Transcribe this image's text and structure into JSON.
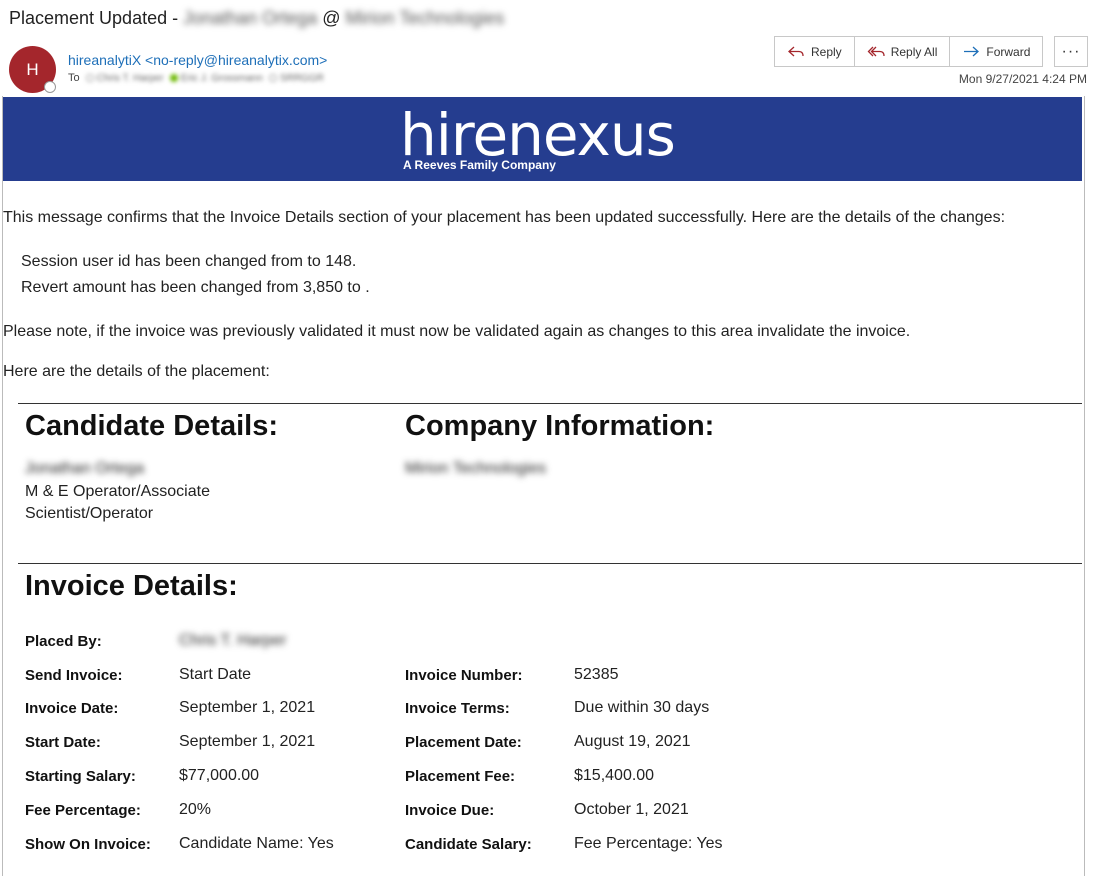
{
  "email": {
    "subject_prefix": "Placement Updated -",
    "subject_candidate": "Jonathan Ortega",
    "subject_at": "@",
    "subject_company": "Mirion Technologies",
    "avatar_letter": "H",
    "sender": "hireanalytiX <no-reply@hireanalytix.com>",
    "to_label": "To",
    "recipients": [
      "Chris T. Harper",
      "Eric J. Grossmann",
      "SRRGGR"
    ],
    "datetime": "Mon 9/27/2021 4:24 PM"
  },
  "actions": {
    "reply": "Reply",
    "reply_all": "Reply All",
    "forward": "Forward",
    "more": "···"
  },
  "banner": {
    "logo_text": "hirenexus",
    "tagline": "A Reeves Family Company",
    "color": "#253d8f"
  },
  "body": {
    "intro": "This message confirms that the Invoice Details section of your placement has been updated successfully. Here are the details of the changes:",
    "changes": [
      "Session user id has been changed from to 148.",
      "Revert amount has been changed from 3,850 to ."
    ],
    "note": "Please note, if the invoice was previously validated it must now be validated again as changes to this area invalidate the invoice.",
    "details_intro": "Here are the details of the placement:"
  },
  "candidate": {
    "heading": "Candidate Details:",
    "name": "Jonathan Ortega",
    "title_line1": "M & E Operator/Associate",
    "title_line2": "Scientist/Operator"
  },
  "company": {
    "heading": "Company Information:",
    "name": "Mirion Technologies"
  },
  "invoice": {
    "heading": "Invoice Details:",
    "placed_by_label": "Placed By:",
    "placed_by_value": "Chris T. Harper",
    "left_rows": [
      {
        "label": "Send Invoice:",
        "value": "Start Date"
      },
      {
        "label": "Invoice Date:",
        "value": "September 1, 2021"
      },
      {
        "label": "Start Date:",
        "value": "September 1, 2021"
      },
      {
        "label": "Starting Salary:",
        "value": "$77,000.00"
      },
      {
        "label": "Fee Percentage:",
        "value": "20%"
      },
      {
        "label": "Show On Invoice:",
        "value": "Candidate Name: Yes"
      }
    ],
    "right_rows": [
      {
        "label": "Invoice Number:",
        "value": "52385"
      },
      {
        "label": "Invoice Terms:",
        "value": "Due within 30 days"
      },
      {
        "label": "Placement Date:",
        "value": "August 19, 2021"
      },
      {
        "label": "Placement Fee:",
        "value": "$15,400.00"
      },
      {
        "label": "Invoice Due:",
        "value": "October 1, 2021"
      },
      {
        "label": "Candidate Salary:",
        "value": "Fee Percentage: Yes"
      }
    ]
  }
}
